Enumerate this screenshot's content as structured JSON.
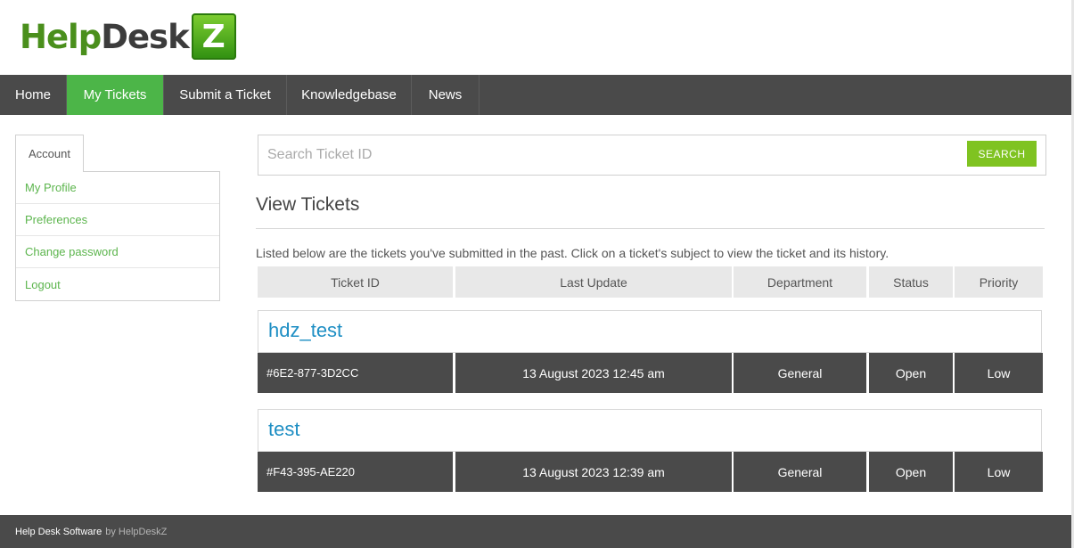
{
  "logo": {
    "help": "Help",
    "desk": "Desk",
    "z": "Z"
  },
  "nav": {
    "items": [
      {
        "label": "Home",
        "active": false
      },
      {
        "label": "My Tickets",
        "active": true
      },
      {
        "label": "Submit a Ticket",
        "active": false
      },
      {
        "label": "Knowledgebase",
        "active": false
      },
      {
        "label": "News",
        "active": false
      }
    ]
  },
  "sidebar": {
    "tab_label": "Account",
    "links": [
      "My Profile",
      "Preferences",
      "Change password",
      "Logout"
    ]
  },
  "search": {
    "placeholder": "Search Ticket ID",
    "button_label": "SEARCH"
  },
  "main": {
    "title": "View Tickets",
    "intro": "Listed below are the tickets you've submitted in the past. Click on a ticket's subject to view the ticket and its history.",
    "columns": [
      "Ticket ID",
      "Last Update",
      "Department",
      "Status",
      "Priority"
    ],
    "tickets": [
      {
        "subject": "hdz_test",
        "id": "#6E2-877-3D2CC",
        "last_update": "13 August 2023 12:45 am",
        "department": "General",
        "status": "Open",
        "priority": "Low"
      },
      {
        "subject": "test",
        "id": "#F43-395-AE220",
        "last_update": "13 August 2023 12:39 am",
        "department": "General",
        "status": "Open",
        "priority": "Low"
      }
    ]
  },
  "footer": {
    "text": "Help Desk Software",
    "by": "by HelpDeskZ"
  },
  "colors": {
    "nav_bg": "#4a4a4a",
    "nav_active": "#4cb548",
    "search_button": "#7fc321",
    "link": "#1f8fc4",
    "sidebar_link": "#5cb54d"
  }
}
